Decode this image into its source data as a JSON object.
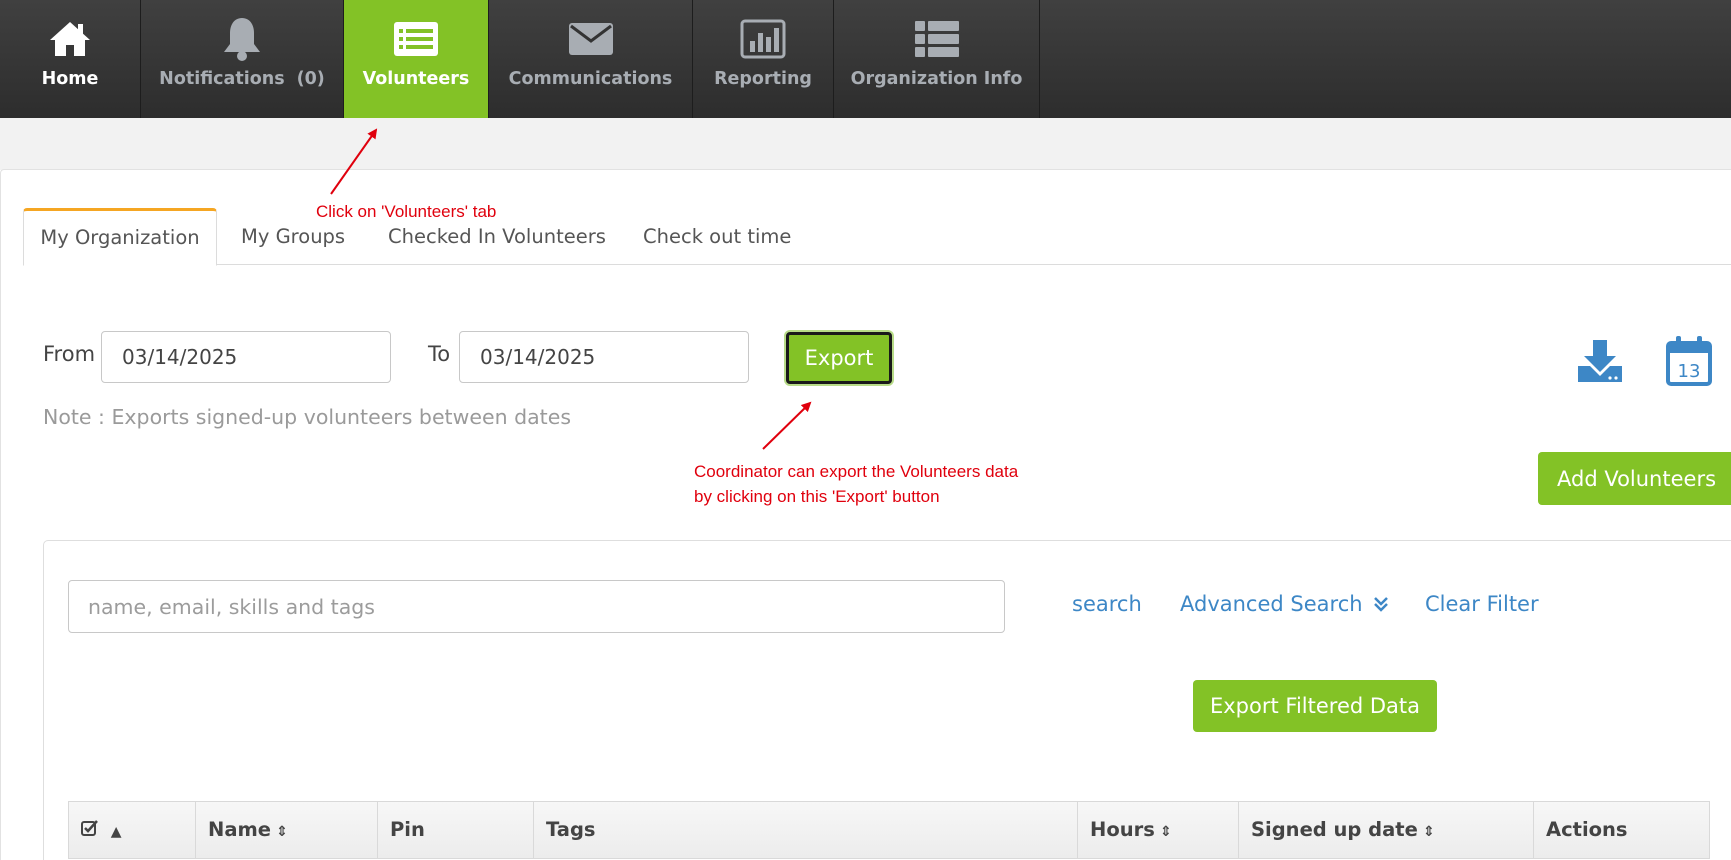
{
  "nav": {
    "home": {
      "label": "Home",
      "icon": "home-icon"
    },
    "notifications": {
      "label": "Notifications",
      "count": "(0)",
      "icon": "bell-icon"
    },
    "volunteers": {
      "label": "Volunteers",
      "icon": "list-card-icon"
    },
    "communications": {
      "label": "Communications",
      "icon": "envelope-icon"
    },
    "reporting": {
      "label": "Reporting",
      "icon": "bar-chart-icon"
    },
    "org_info": {
      "label": "Organization Info",
      "icon": "list-icon"
    }
  },
  "annotations": {
    "tab_hint": "Click on 'Volunteers' tab",
    "export_hint_line1": "Coordinator can export the Volunteers data",
    "export_hint_line2": "by clicking on this 'Export' button"
  },
  "subtabs": [
    "My Organization",
    "My Groups",
    "Checked In Volunteers",
    "Check out time"
  ],
  "date_range": {
    "from_label": "From",
    "from_value": "03/14/2025",
    "to_label": "To",
    "to_value": "03/14/2025",
    "export_label": "Export",
    "note": "Note : Exports signed-up volunteers between dates"
  },
  "calendar_day": "13",
  "add_volunteers_label": "Add Volunteers",
  "search": {
    "placeholder": "name, email, skills and tags",
    "search_link": "search",
    "advanced_link": "Advanced Search",
    "clear_link": "Clear Filter",
    "export_filtered_label": "Export Filtered Data"
  },
  "table": {
    "columns": [
      "",
      "Name",
      "Pin",
      "Tags",
      "Hours",
      "Signed up date",
      "Actions"
    ]
  },
  "colors": {
    "accent_green": "#83c226",
    "link_blue": "#3d87c6",
    "annotation_red": "#e0000d",
    "active_tab_border": "#f5a623"
  }
}
